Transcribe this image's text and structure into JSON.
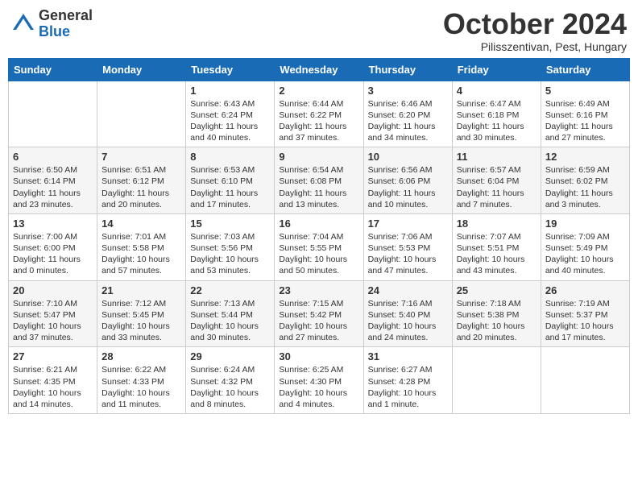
{
  "header": {
    "logo_general": "General",
    "logo_blue": "Blue",
    "month_title": "October 2024",
    "location": "Pilisszentivan, Pest, Hungary"
  },
  "days_of_week": [
    "Sunday",
    "Monday",
    "Tuesday",
    "Wednesday",
    "Thursday",
    "Friday",
    "Saturday"
  ],
  "weeks": [
    [
      {
        "day": "",
        "info": ""
      },
      {
        "day": "",
        "info": ""
      },
      {
        "day": "1",
        "info": "Sunrise: 6:43 AM\nSunset: 6:24 PM\nDaylight: 11 hours and 40 minutes."
      },
      {
        "day": "2",
        "info": "Sunrise: 6:44 AM\nSunset: 6:22 PM\nDaylight: 11 hours and 37 minutes."
      },
      {
        "day": "3",
        "info": "Sunrise: 6:46 AM\nSunset: 6:20 PM\nDaylight: 11 hours and 34 minutes."
      },
      {
        "day": "4",
        "info": "Sunrise: 6:47 AM\nSunset: 6:18 PM\nDaylight: 11 hours and 30 minutes."
      },
      {
        "day": "5",
        "info": "Sunrise: 6:49 AM\nSunset: 6:16 PM\nDaylight: 11 hours and 27 minutes."
      }
    ],
    [
      {
        "day": "6",
        "info": "Sunrise: 6:50 AM\nSunset: 6:14 PM\nDaylight: 11 hours and 23 minutes."
      },
      {
        "day": "7",
        "info": "Sunrise: 6:51 AM\nSunset: 6:12 PM\nDaylight: 11 hours and 20 minutes."
      },
      {
        "day": "8",
        "info": "Sunrise: 6:53 AM\nSunset: 6:10 PM\nDaylight: 11 hours and 17 minutes."
      },
      {
        "day": "9",
        "info": "Sunrise: 6:54 AM\nSunset: 6:08 PM\nDaylight: 11 hours and 13 minutes."
      },
      {
        "day": "10",
        "info": "Sunrise: 6:56 AM\nSunset: 6:06 PM\nDaylight: 11 hours and 10 minutes."
      },
      {
        "day": "11",
        "info": "Sunrise: 6:57 AM\nSunset: 6:04 PM\nDaylight: 11 hours and 7 minutes."
      },
      {
        "day": "12",
        "info": "Sunrise: 6:59 AM\nSunset: 6:02 PM\nDaylight: 11 hours and 3 minutes."
      }
    ],
    [
      {
        "day": "13",
        "info": "Sunrise: 7:00 AM\nSunset: 6:00 PM\nDaylight: 11 hours and 0 minutes."
      },
      {
        "day": "14",
        "info": "Sunrise: 7:01 AM\nSunset: 5:58 PM\nDaylight: 10 hours and 57 minutes."
      },
      {
        "day": "15",
        "info": "Sunrise: 7:03 AM\nSunset: 5:56 PM\nDaylight: 10 hours and 53 minutes."
      },
      {
        "day": "16",
        "info": "Sunrise: 7:04 AM\nSunset: 5:55 PM\nDaylight: 10 hours and 50 minutes."
      },
      {
        "day": "17",
        "info": "Sunrise: 7:06 AM\nSunset: 5:53 PM\nDaylight: 10 hours and 47 minutes."
      },
      {
        "day": "18",
        "info": "Sunrise: 7:07 AM\nSunset: 5:51 PM\nDaylight: 10 hours and 43 minutes."
      },
      {
        "day": "19",
        "info": "Sunrise: 7:09 AM\nSunset: 5:49 PM\nDaylight: 10 hours and 40 minutes."
      }
    ],
    [
      {
        "day": "20",
        "info": "Sunrise: 7:10 AM\nSunset: 5:47 PM\nDaylight: 10 hours and 37 minutes."
      },
      {
        "day": "21",
        "info": "Sunrise: 7:12 AM\nSunset: 5:45 PM\nDaylight: 10 hours and 33 minutes."
      },
      {
        "day": "22",
        "info": "Sunrise: 7:13 AM\nSunset: 5:44 PM\nDaylight: 10 hours and 30 minutes."
      },
      {
        "day": "23",
        "info": "Sunrise: 7:15 AM\nSunset: 5:42 PM\nDaylight: 10 hours and 27 minutes."
      },
      {
        "day": "24",
        "info": "Sunrise: 7:16 AM\nSunset: 5:40 PM\nDaylight: 10 hours and 24 minutes."
      },
      {
        "day": "25",
        "info": "Sunrise: 7:18 AM\nSunset: 5:38 PM\nDaylight: 10 hours and 20 minutes."
      },
      {
        "day": "26",
        "info": "Sunrise: 7:19 AM\nSunset: 5:37 PM\nDaylight: 10 hours and 17 minutes."
      }
    ],
    [
      {
        "day": "27",
        "info": "Sunrise: 6:21 AM\nSunset: 4:35 PM\nDaylight: 10 hours and 14 minutes."
      },
      {
        "day": "28",
        "info": "Sunrise: 6:22 AM\nSunset: 4:33 PM\nDaylight: 10 hours and 11 minutes."
      },
      {
        "day": "29",
        "info": "Sunrise: 6:24 AM\nSunset: 4:32 PM\nDaylight: 10 hours and 8 minutes."
      },
      {
        "day": "30",
        "info": "Sunrise: 6:25 AM\nSunset: 4:30 PM\nDaylight: 10 hours and 4 minutes."
      },
      {
        "day": "31",
        "info": "Sunrise: 6:27 AM\nSunset: 4:28 PM\nDaylight: 10 hours and 1 minute."
      },
      {
        "day": "",
        "info": ""
      },
      {
        "day": "",
        "info": ""
      }
    ]
  ]
}
